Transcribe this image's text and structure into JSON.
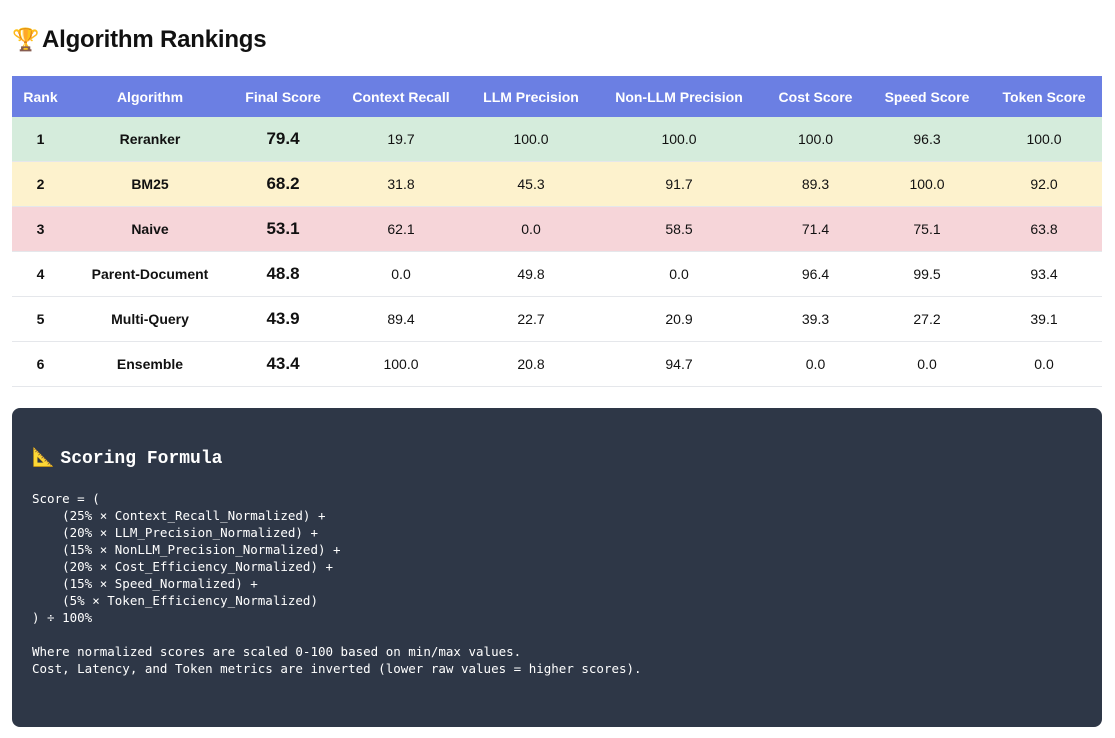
{
  "page": {
    "title": "Algorithm Rankings",
    "title_icon": "🏆"
  },
  "table": {
    "headers": [
      "Rank",
      "Algorithm",
      "Final Score",
      "Context Recall",
      "LLM Precision",
      "Non-LLM Precision",
      "Cost Score",
      "Speed Score",
      "Token Score"
    ],
    "rows": [
      {
        "rank": "1",
        "algorithm": "Reranker",
        "final_score": "79.4",
        "context_recall": "19.7",
        "llm_precision": "100.0",
        "non_llm_precision": "100.0",
        "cost_score": "100.0",
        "speed_score": "96.3",
        "token_score": "100.0"
      },
      {
        "rank": "2",
        "algorithm": "BM25",
        "final_score": "68.2",
        "context_recall": "31.8",
        "llm_precision": "45.3",
        "non_llm_precision": "91.7",
        "cost_score": "89.3",
        "speed_score": "100.0",
        "token_score": "92.0"
      },
      {
        "rank": "3",
        "algorithm": "Naive",
        "final_score": "53.1",
        "context_recall": "62.1",
        "llm_precision": "0.0",
        "non_llm_precision": "58.5",
        "cost_score": "71.4",
        "speed_score": "75.1",
        "token_score": "63.8"
      },
      {
        "rank": "4",
        "algorithm": "Parent-Document",
        "final_score": "48.8",
        "context_recall": "0.0",
        "llm_precision": "49.8",
        "non_llm_precision": "0.0",
        "cost_score": "96.4",
        "speed_score": "99.5",
        "token_score": "93.4"
      },
      {
        "rank": "5",
        "algorithm": "Multi-Query",
        "final_score": "43.9",
        "context_recall": "89.4",
        "llm_precision": "22.7",
        "non_llm_precision": "20.9",
        "cost_score": "39.3",
        "speed_score": "27.2",
        "token_score": "39.1"
      },
      {
        "rank": "6",
        "algorithm": "Ensemble",
        "final_score": "43.4",
        "context_recall": "100.0",
        "llm_precision": "20.8",
        "non_llm_precision": "94.7",
        "cost_score": "0.0",
        "speed_score": "0.0",
        "token_score": "0.0"
      }
    ],
    "colors": {
      "header_bg": "#6b7fe3",
      "first_place_bg": "#d5ecdc",
      "second_place_bg": "#fdf2cd",
      "third_place_bg": "#f6d5d9"
    }
  },
  "formula": {
    "icon": "📐",
    "title": "Scoring Formula",
    "text": "Score = (\n    (25% × Context_Recall_Normalized) +\n    (20% × LLM_Precision_Normalized) +\n    (15% × NonLLM_Precision_Normalized) +\n    (20% × Cost_Efficiency_Normalized) +\n    (15% × Speed_Normalized) +\n    (5% × Token_Efficiency_Normalized)\n) ÷ 100%\n\nWhere normalized scores are scaled 0-100 based on min/max values.\nCost, Latency, and Token metrics are inverted (lower raw values = higher scores).",
    "bg_color": "#2e3747"
  }
}
